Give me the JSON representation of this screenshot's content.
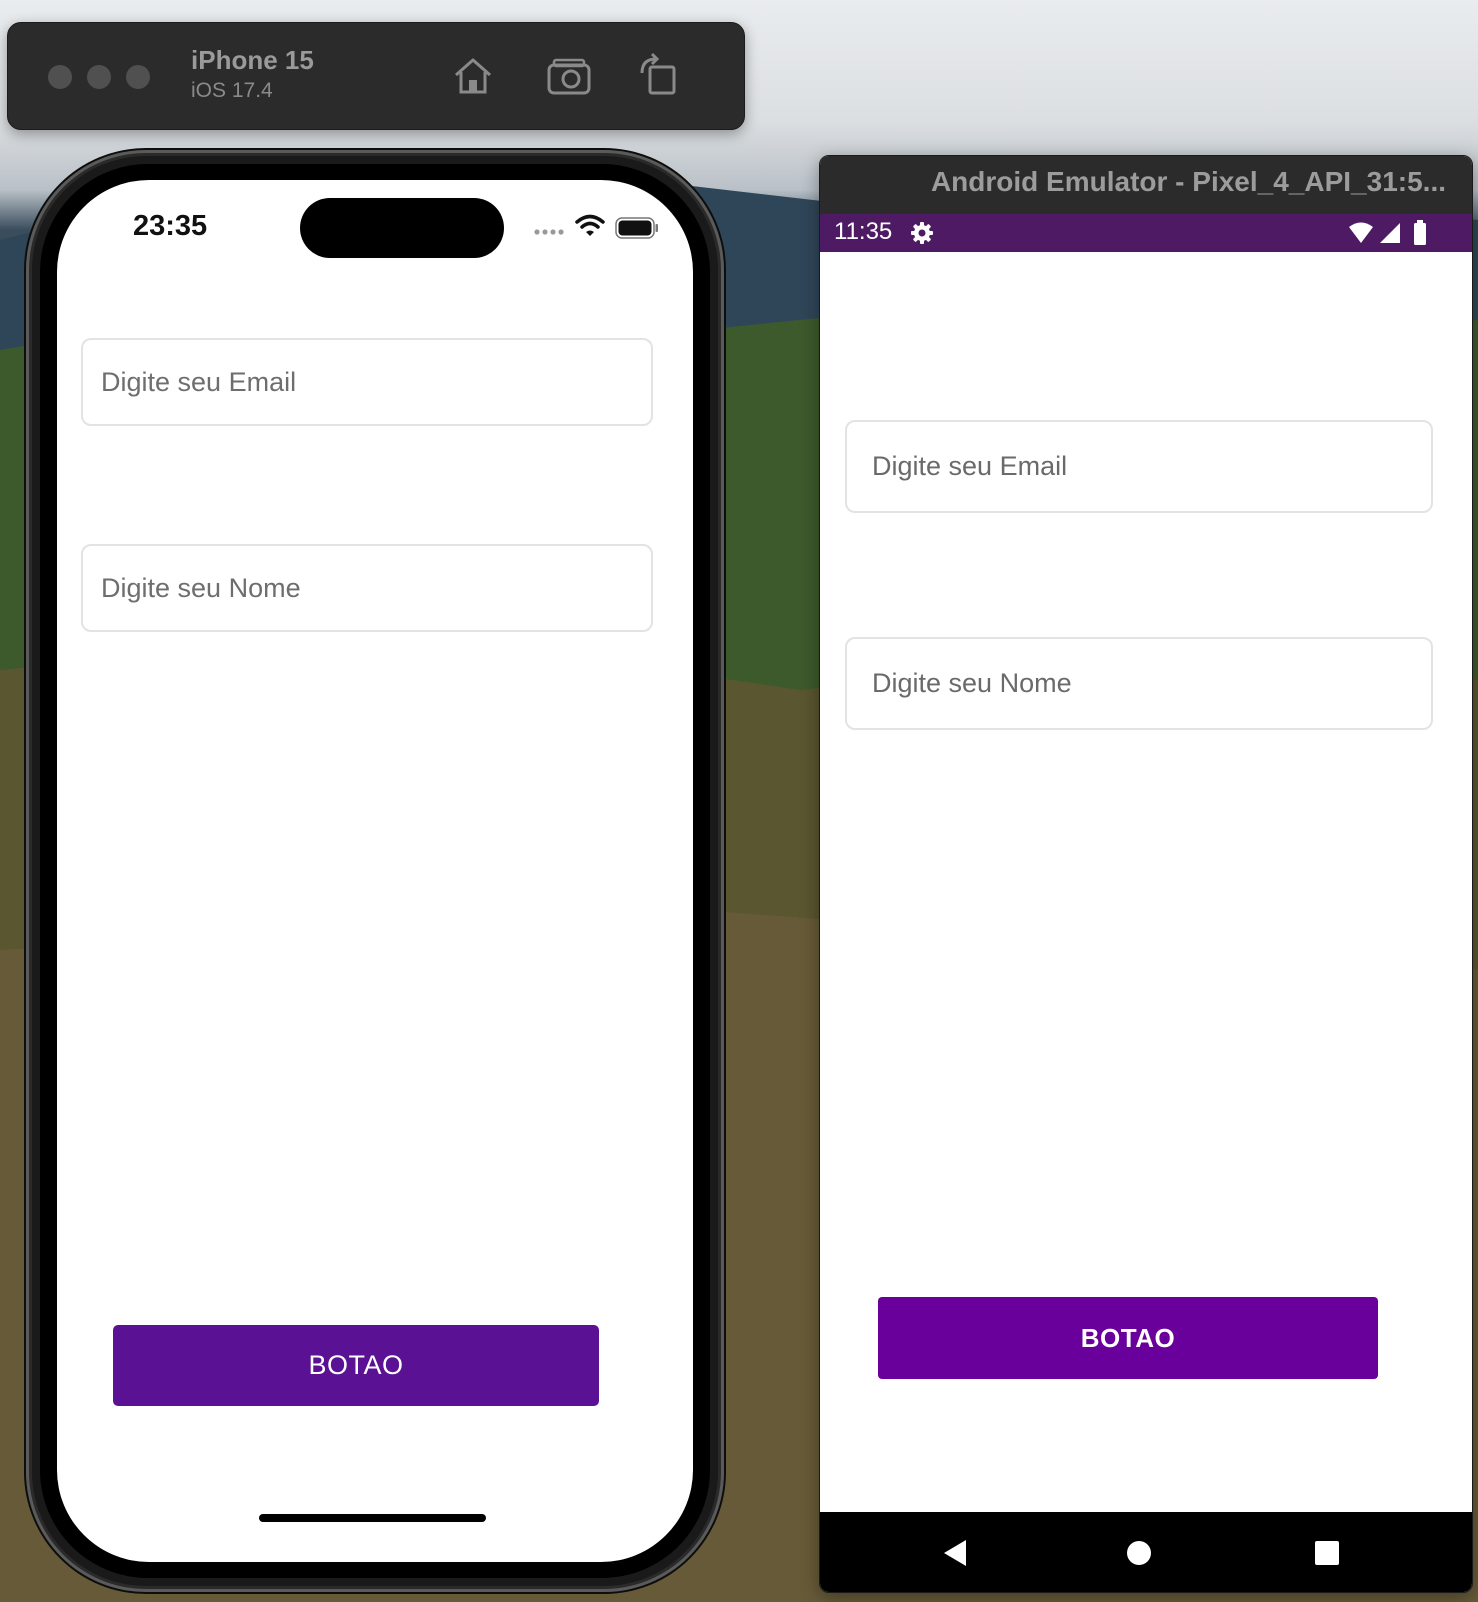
{
  "simulator": {
    "device_name": "iPhone 15",
    "os_version": "iOS 17.4",
    "toolbar_icons": [
      "home-icon",
      "screenshot-icon",
      "rotate-icon"
    ]
  },
  "ios_app": {
    "status_time": "23:35",
    "email_placeholder": "Digite seu Email",
    "name_placeholder": "Digite seu Nome",
    "button_label": "BOTAO",
    "button_color": "#5b1194"
  },
  "android_emulator": {
    "window_title": "Android Emulator - Pixel_4_API_31:5...",
    "status_time": "11:35",
    "status_bar_color": "#4d1a63",
    "email_placeholder": "Digite seu Email",
    "name_placeholder": "Digite seu Nome",
    "button_label": "BOTAO",
    "button_color": "#6a009c",
    "nav_icons": [
      "back-icon",
      "home-icon",
      "recents-icon"
    ]
  }
}
